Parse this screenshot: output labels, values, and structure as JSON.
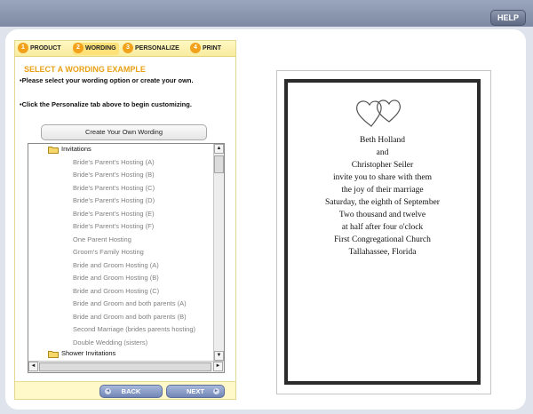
{
  "header": {
    "help_label": "HELP"
  },
  "steps": [
    {
      "num": "1",
      "label": "PRODUCT"
    },
    {
      "num": "2",
      "label": "WORDING"
    },
    {
      "num": "3",
      "label": "PERSONALIZE"
    },
    {
      "num": "4",
      "label": "PRINT"
    }
  ],
  "panel": {
    "title": "SELECT A WORDING EXAMPLE",
    "instruction_1": "•Please select your wording option or create your own.",
    "instruction_2": "•Click the Personalize tab above to begin customizing.",
    "create_button": "Create Your Own Wording"
  },
  "tree": {
    "folders": [
      "Invitations",
      "Shower Invitations"
    ],
    "items": [
      "Bride's Parent's Hosting (A)",
      "Bride's Parent's Hosting (B)",
      "Bride's Parent's Hosting (C)",
      "Bride's Parent's Hosting (D)",
      "Bride's Parent's Hosting (E)",
      "Bride's Parent's Hosting (F)",
      "One Parent Hosting",
      "Groom's Family Hosting",
      "Bride and Groom Hosting (A)",
      "Bride and Groom Hosting (B)",
      "Bride and Groom Hosting (C)",
      "Bride and Groom and both parents (A)",
      "Bride and Groom and both parents (B)",
      "Second Marriage (brides parents hosting)",
      "Double Wedding (sisters)"
    ]
  },
  "nav": {
    "back": "BACK",
    "next": "NEXT"
  },
  "preview": {
    "lines": [
      "Beth Holland",
      "and",
      "Christopher Seiler",
      "invite you to share with them",
      "the joy of their marriage",
      "Saturday, the eighth of September",
      "Two thousand and twelve",
      "at half after four o'clock",
      "First Congregational Church",
      "Tallahassee, Florida"
    ]
  },
  "colors": {
    "accent_orange": "#f2a11a",
    "title_orange": "#e8a116",
    "button_blue": "#7186b6",
    "header_bar": "#8a96ae"
  },
  "icons": [
    "folder-icon",
    "hearts-icon",
    "arrow-left-icon",
    "arrow-right-icon",
    "scroll-up-icon",
    "scroll-down-icon",
    "scroll-left-icon",
    "scroll-right-icon"
  ]
}
